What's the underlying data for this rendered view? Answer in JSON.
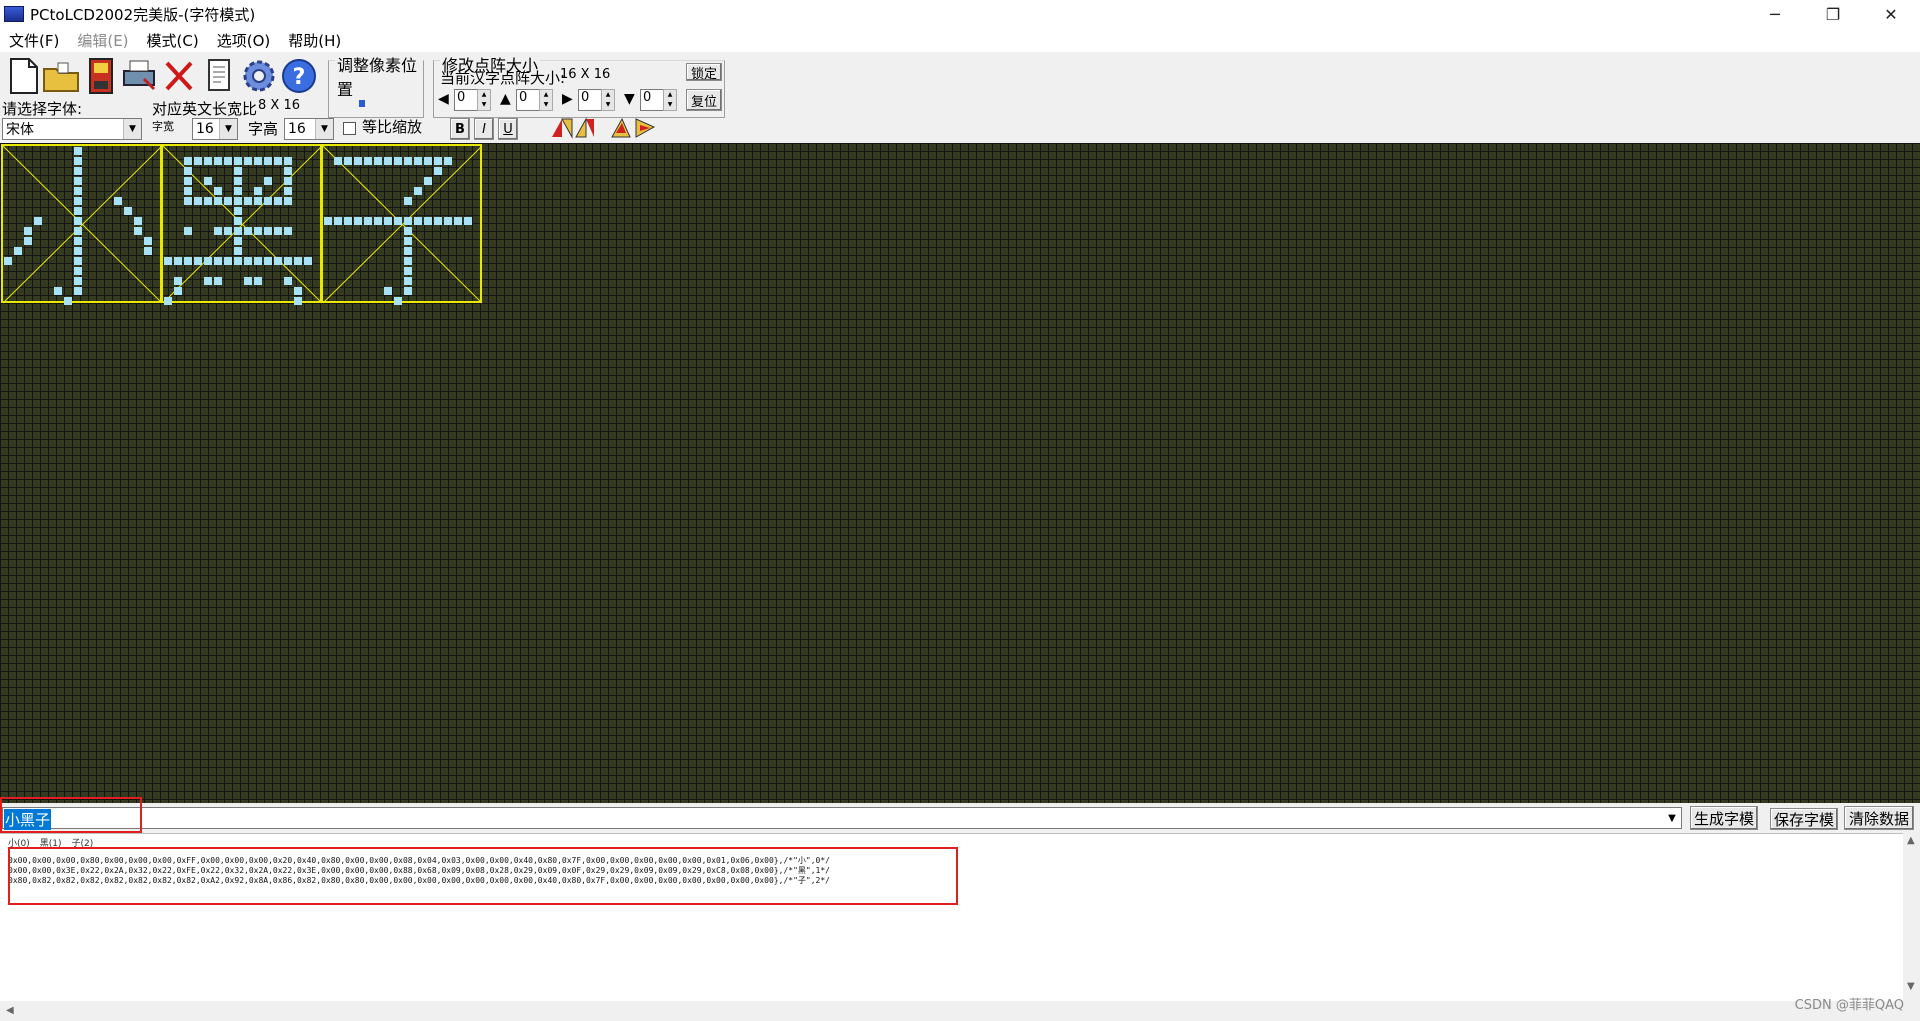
{
  "window": {
    "title": "PCtoLCD2002完美版-(字符模式)",
    "minimize": "─",
    "restore": "❐",
    "close": "✕"
  },
  "menu": [
    "文件(F)",
    "编辑(E)",
    "模式(C)",
    "选项(O)",
    "帮助(H)"
  ],
  "toolbar": {
    "adjust_group_title": "调整像素位置",
    "resize_group_title": "修改点阵大小",
    "current_size_label": "当前汉字点阵大小:",
    "current_size_value": "16 X 16",
    "lock_button": "锁定",
    "reset_button": "复位",
    "spin_values": [
      "0",
      "0",
      "0",
      "0"
    ],
    "font_label": "请选择字体:",
    "font_value": "宋体",
    "ratio_label": "对应英文长宽比",
    "ratio_value": "8 X 16",
    "width_label": "字宽",
    "width_value": "16",
    "height_label": "字高",
    "height_value": "16",
    "proportional_label": "等比缩放",
    "bold": "B",
    "italic": "I",
    "underline": "U"
  },
  "canvas": {
    "background_color": "#333a20",
    "pixel_color": "#a8e2f4",
    "frame_color": "#e8e800",
    "characters": [
      "小",
      "黑",
      "子"
    ]
  },
  "input": {
    "text": "小黑子"
  },
  "actions": {
    "generate": "生成字模",
    "save": "保存字模",
    "clear": "清除数据"
  },
  "output": {
    "tabs": [
      "小(0)",
      "黑(1)",
      "子(2)"
    ],
    "lines": [
      "0x00,0x00,0x00,0x80,0x00,0x00,0x00,0xFF,0x00,0x00,0x00,0x20,0x40,0x80,0x00,0x00,0x08,0x04,0x03,0x00,0x00,0x40,0x80,0x7F,0x00,0x00,0x00,0x00,0x00,0x01,0x06,0x00},/*\"小\",0*/",
      "0x00,0x00,0x3E,0x22,0x2A,0x32,0x22,0xFE,0x22,0x32,0x2A,0x22,0x3E,0x00,0x00,0x00,0x88,0x68,0x09,0x08,0x28,0x29,0x09,0x0F,0x29,0x29,0x09,0x09,0x29,0xC8,0x08,0x00},/*\"黑\",1*/",
      "0x80,0x82,0x82,0x82,0x82,0x82,0x82,0x82,0xA2,0x92,0x8A,0x86,0x82,0x80,0x80,0x00,0x00,0x00,0x00,0x00,0x00,0x00,0x40,0x80,0x7F,0x00,0x00,0x00,0x00,0x00,0x00,0x00},/*\"子\",2*/"
    ]
  },
  "watermark": "CSDN @菲菲QAQ"
}
